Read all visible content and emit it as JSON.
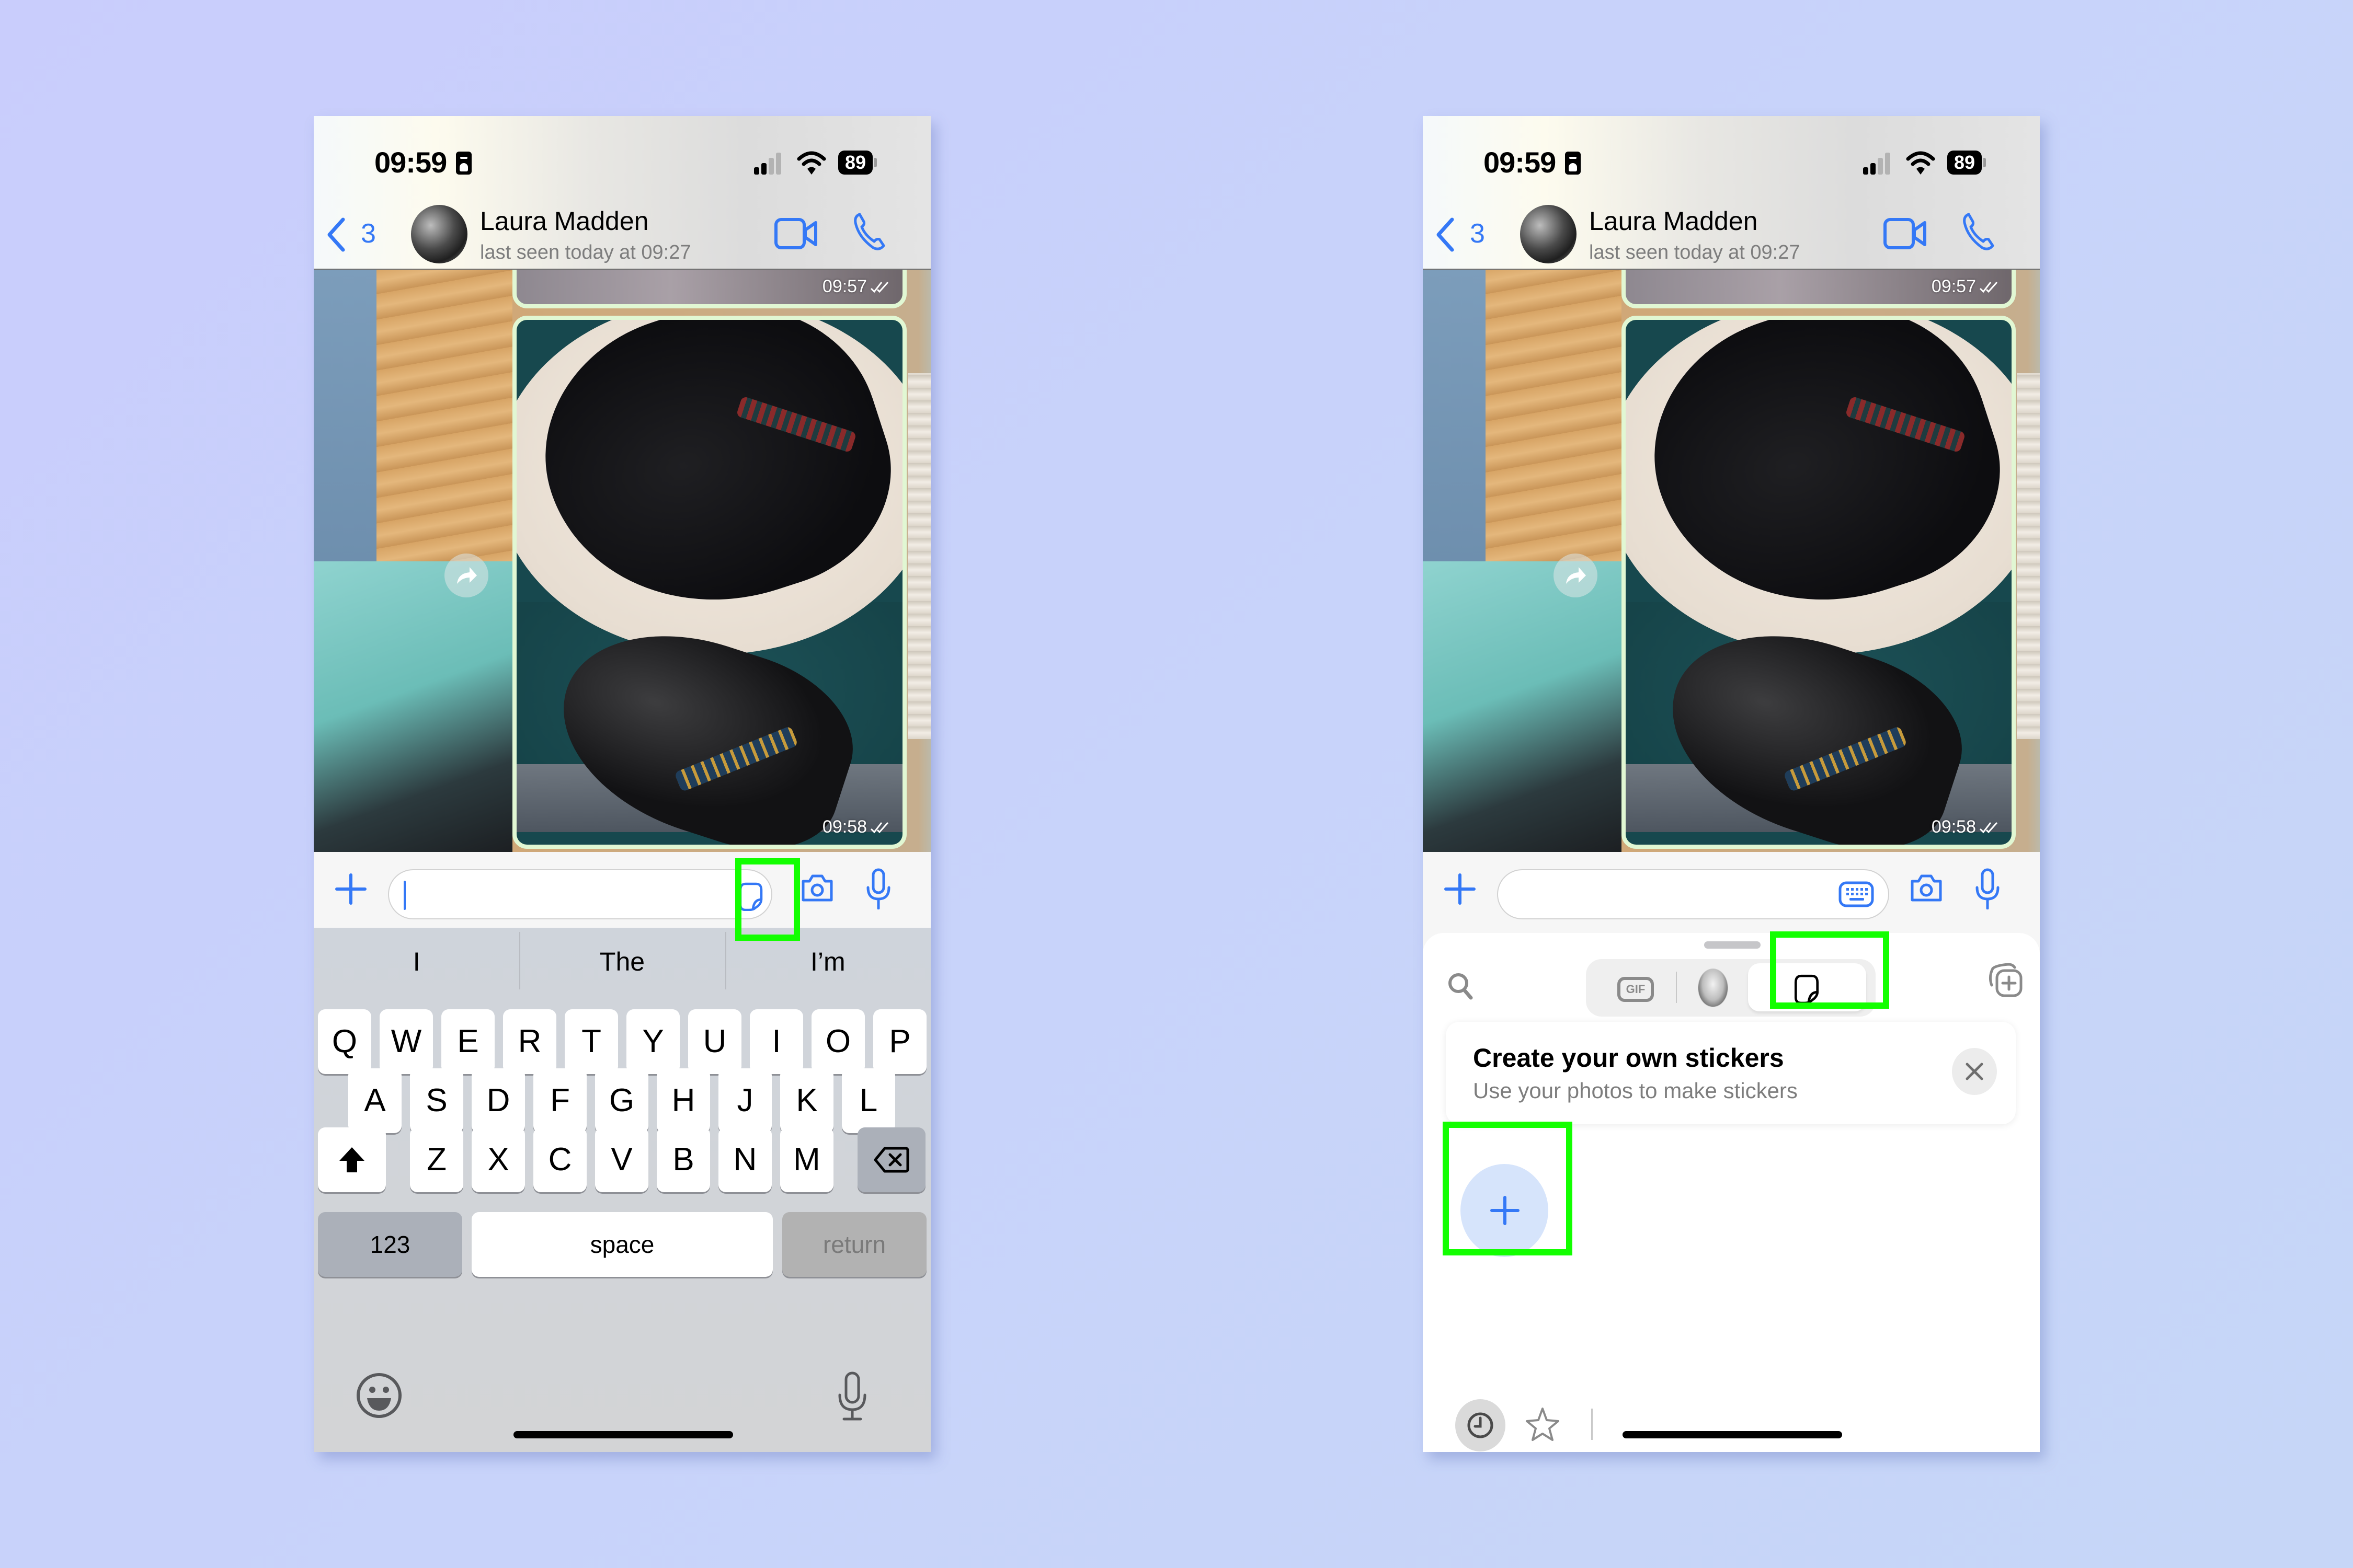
{
  "colors": {
    "accent": "#3478f6",
    "highlight": "#12ff00",
    "bubble_outgoing": "#dcf8c6",
    "background": "#c9cdfc"
  },
  "panels": [
    {
      "id": "left",
      "status_bar": {
        "time": "09:59",
        "battery": "89"
      },
      "header": {
        "back_count": "3",
        "contact_name": "Laura Madden",
        "contact_status": "last seen today at 09:27"
      },
      "messages": [
        {
          "type": "photo",
          "time": "09:57",
          "ticks": "read"
        },
        {
          "type": "photo",
          "time": "09:58",
          "ticks": "read"
        }
      ],
      "input": {
        "value": "",
        "placeholder": "",
        "right_icon": "sticker-icon"
      },
      "keyboard": {
        "suggestions": [
          "I",
          "The",
          "I’m"
        ],
        "row1": [
          "Q",
          "W",
          "E",
          "R",
          "T",
          "Y",
          "U",
          "I",
          "O",
          "P"
        ],
        "row2": [
          "A",
          "S",
          "D",
          "F",
          "G",
          "H",
          "J",
          "K",
          "L"
        ],
        "row3": [
          "Z",
          "X",
          "C",
          "V",
          "B",
          "N",
          "M"
        ],
        "numbers_label": "123",
        "space_label": "space",
        "return_label": "return"
      },
      "highlighted": "sticker-button"
    },
    {
      "id": "right",
      "status_bar": {
        "time": "09:59",
        "battery": "89"
      },
      "header": {
        "back_count": "3",
        "contact_name": "Laura Madden",
        "contact_status": "last seen today at 09:27"
      },
      "messages": [
        {
          "type": "photo",
          "time": "09:57",
          "ticks": "read"
        },
        {
          "type": "photo",
          "time": "09:58",
          "ticks": "read"
        }
      ],
      "input": {
        "value": "",
        "placeholder": "",
        "right_icon": "keyboard-icon"
      },
      "sticker_panel": {
        "tabs": [
          "GIF",
          "avatar",
          "stickers"
        ],
        "active_tab": "stickers",
        "gif_label": "GIF",
        "promo_title": "Create your own stickers",
        "promo_subtitle": "Use your photos to make stickers",
        "bottom_tabs": [
          "recent",
          "favorites"
        ]
      },
      "highlighted": [
        "stickers-tab",
        "create-sticker-button"
      ]
    }
  ]
}
